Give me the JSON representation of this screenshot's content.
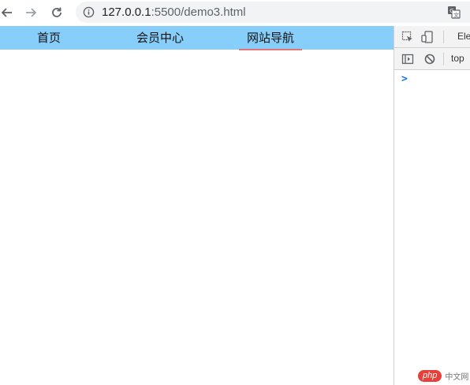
{
  "browser": {
    "url_host": "127.0.0.1",
    "url_rest": ":5500/demo3.html",
    "icons": {
      "back": "arrow-left-icon",
      "forward": "arrow-right-icon",
      "reload": "reload-icon",
      "info": "info-icon",
      "translate": "translate-icon"
    }
  },
  "nav": {
    "background": "#87cefa",
    "active_underline": "#e57373",
    "items": [
      {
        "label": "首页"
      },
      {
        "label": "会员中心"
      },
      {
        "label": "网站导航",
        "active": true
      }
    ]
  },
  "devtools": {
    "tab_elements": "Ele",
    "context": "top",
    "prompt": ">",
    "icons": [
      "inspect-element-icon",
      "device-toolbar-icon",
      "show-sidebar-icon",
      "clear-console-icon"
    ]
  },
  "watermark": {
    "badge": "php",
    "text": "中文网"
  }
}
